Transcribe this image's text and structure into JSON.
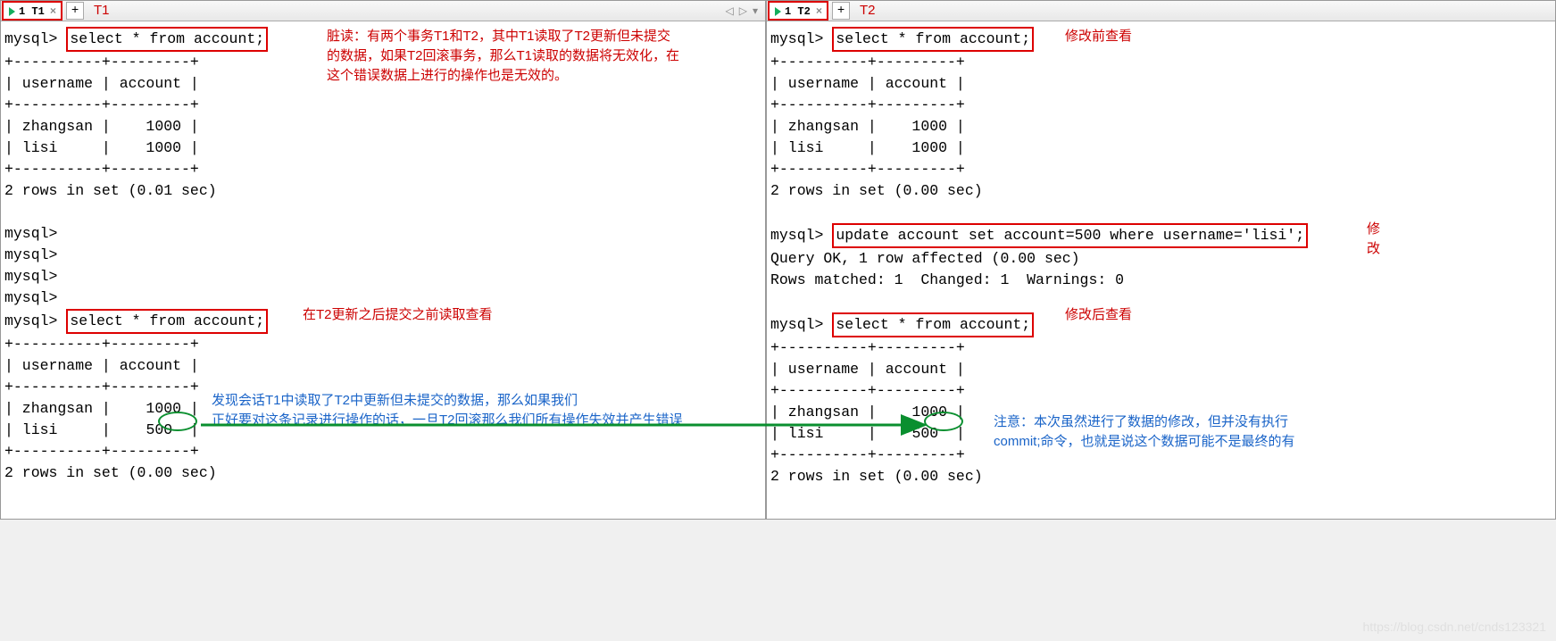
{
  "left": {
    "tab": {
      "label": "1 T1",
      "ext_label": "T1"
    },
    "prompt": "mysql>",
    "query1": "select * from account;",
    "table1": {
      "border_top": "+----------+---------+",
      "header": "| username | account |",
      "border_mid": "+----------+---------+",
      "row1": "| zhangsan |    1000 |",
      "row2": "| lisi     |    1000 |",
      "border_bot": "+----------+---------+",
      "footer": "2 rows in set (0.01 sec)"
    },
    "empty_prompts": [
      "mysql>",
      "mysql>",
      "mysql>",
      "mysql>"
    ],
    "query2": "select * from account;",
    "table2": {
      "border_top": "+----------+---------+",
      "header": "| username | account |",
      "border_mid": "+----------+---------+",
      "row1": "| zhangsan |    1000 |",
      "row2_pre": "| lisi     |    ",
      "row2_val": "500",
      "row2_post": "  |",
      "border_bot": "+----------+---------+",
      "footer": "2 rows in set (0.00 sec)"
    },
    "anno_dirty_read": "脏读：有两个事务T1和T2，其中T1读取了T2更新但未提交\n的数据，如果T2回滚事务，那么T1读取的数据将无效化，在\n这个错误数据上进行的操作也是无效的。",
    "anno_mid": "在T2更新之后提交之前读取查看",
    "anno_bottom": "发现会话T1中读取了T2中更新但未提交的数据，那么如果我们\n正好要对这条记录进行操作的话，一旦T2回滚那么我们所有操作失效并产生错误"
  },
  "right": {
    "tab": {
      "label": "1 T2",
      "ext_label": "T2"
    },
    "prompt": "mysql>",
    "query1": "select * from account;",
    "anno_q1": "修改前查看",
    "table1": {
      "border_top": "+----------+---------+",
      "header": "| username | account |",
      "border_mid": "+----------+---------+",
      "row1": "| zhangsan |    1000 |",
      "row2": "| lisi     |    1000 |",
      "border_bot": "+----------+---------+",
      "footer": "2 rows in set (0.00 sec)"
    },
    "update_stmt": "update account set account=500 where username='lisi';",
    "anno_update": "修\n改",
    "update_res1": "Query OK, 1 row affected (0.00 sec)",
    "update_res2": "Rows matched: 1  Changed: 1  Warnings: 0",
    "query2": "select * from account;",
    "anno_q2": "修改后查看",
    "table2": {
      "border_top": "+----------+---------+",
      "header": "| username | account |",
      "border_mid": "+----------+---------+",
      "row1": "| zhangsan |    1000 |",
      "row2_pre": "| lisi     |    ",
      "row2_val": "500",
      "row2_post": "  |",
      "border_bot": "+----------+---------+",
      "footer": "2 rows in set (0.00 sec)"
    },
    "anno_note": "注意：本次虽然进行了数据的修改，但并没有执行\ncommit;命令，也就是说这个数据可能不是最终的有"
  },
  "watermark": "https://blog.csdn.net/cnds123321"
}
